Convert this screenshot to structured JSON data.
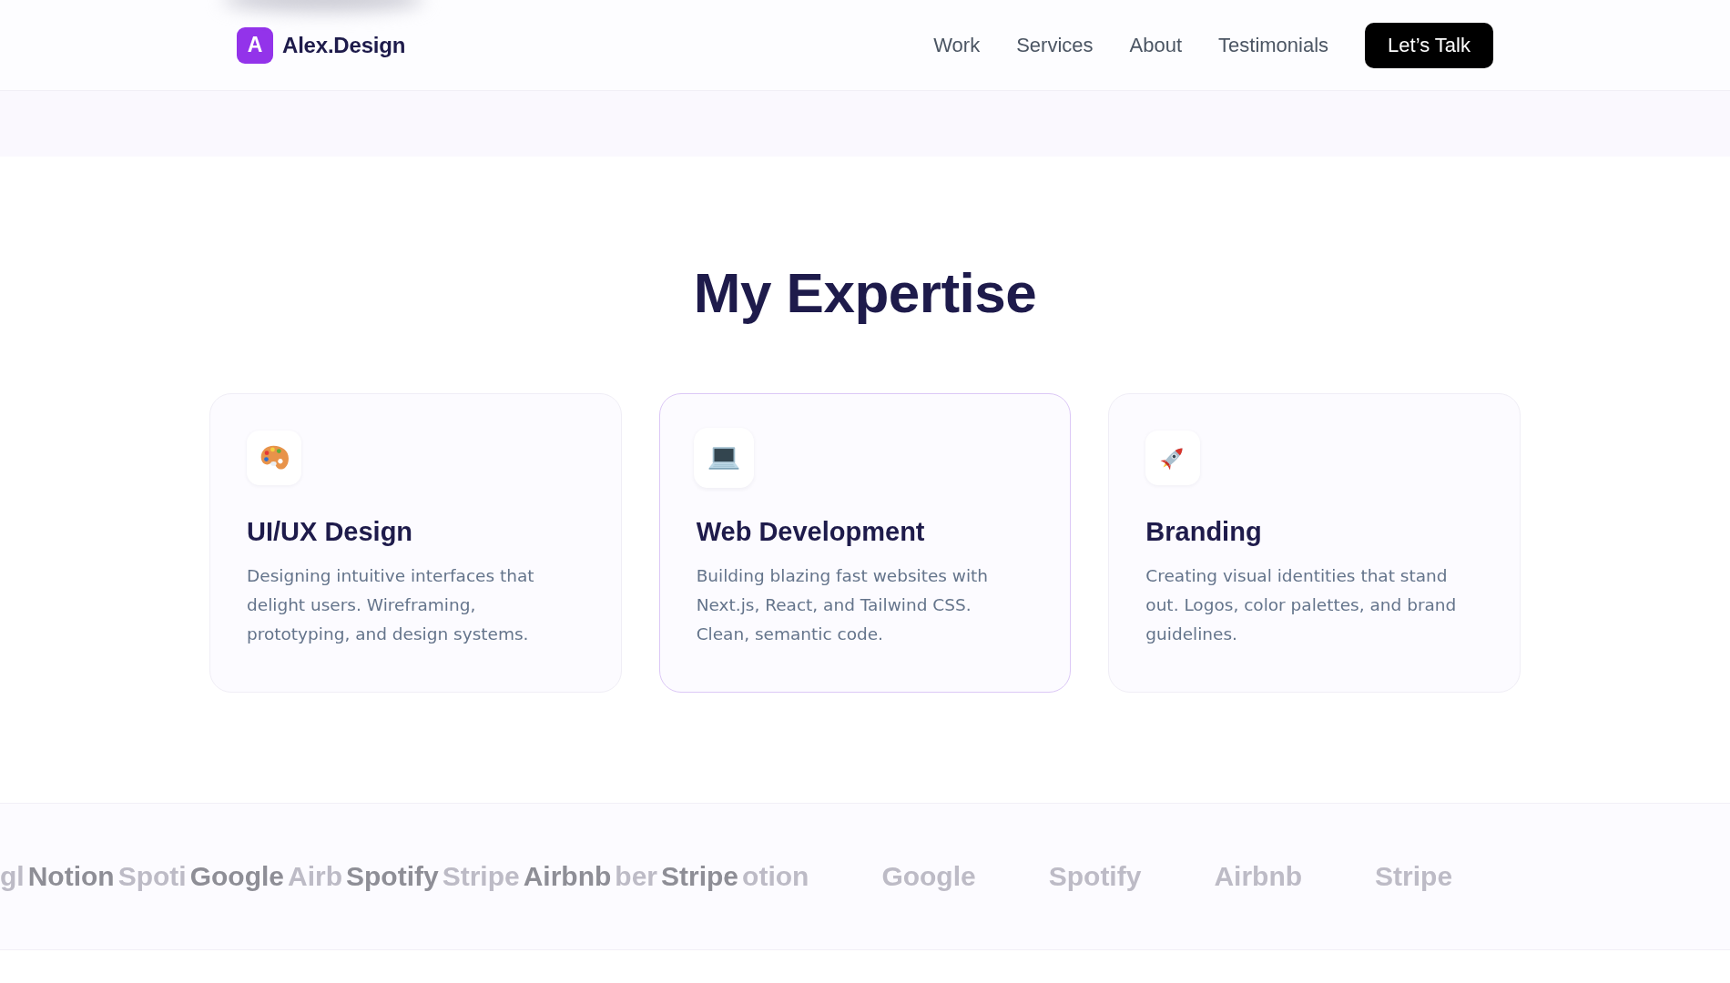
{
  "header": {
    "logo": {
      "letter": "A",
      "name": "Alex.Design"
    },
    "nav": [
      "Work",
      "Services",
      "About",
      "Testimonials"
    ],
    "cta": "Let’s Talk"
  },
  "expertise": {
    "title": "My Expertise",
    "cards": [
      {
        "title": "UI/UX Design",
        "description": "Designing intuitive interfaces that delight users. Wireframing, prototyping, and design systems.",
        "highlighted": false
      },
      {
        "title": "Web Development",
        "description": "Building blazing fast websites with Next.js, React, and Tailwind CSS. Clean, semantic code.",
        "highlighted": true
      },
      {
        "title": "Branding",
        "description": "Creating visual identities that stand out. Logos, color palettes, and brand guidelines.",
        "highlighted": false
      }
    ]
  },
  "logo_strip": [
    {
      "label": "gl",
      "faded": true
    },
    {
      "label": "Notion",
      "faded": false
    },
    {
      "label": "Spoti",
      "faded": true
    },
    {
      "label": "Google",
      "faded": false
    },
    {
      "label": "Airb",
      "faded": true
    },
    {
      "label": "Spotify",
      "faded": false
    },
    {
      "label": "Stripe",
      "faded": true
    },
    {
      "label": "Airbnb",
      "faded": false
    },
    {
      "label": "ber",
      "faded": true
    },
    {
      "label": "Stripe",
      "faded": false
    },
    {
      "label": "otion",
      "faded": true
    },
    {
      "label": "Google",
      "faded": true
    },
    {
      "label": "Spotify",
      "faded": true
    },
    {
      "label": "Airbnb",
      "faded": true
    },
    {
      "label": "Stripe",
      "faded": true
    }
  ]
}
